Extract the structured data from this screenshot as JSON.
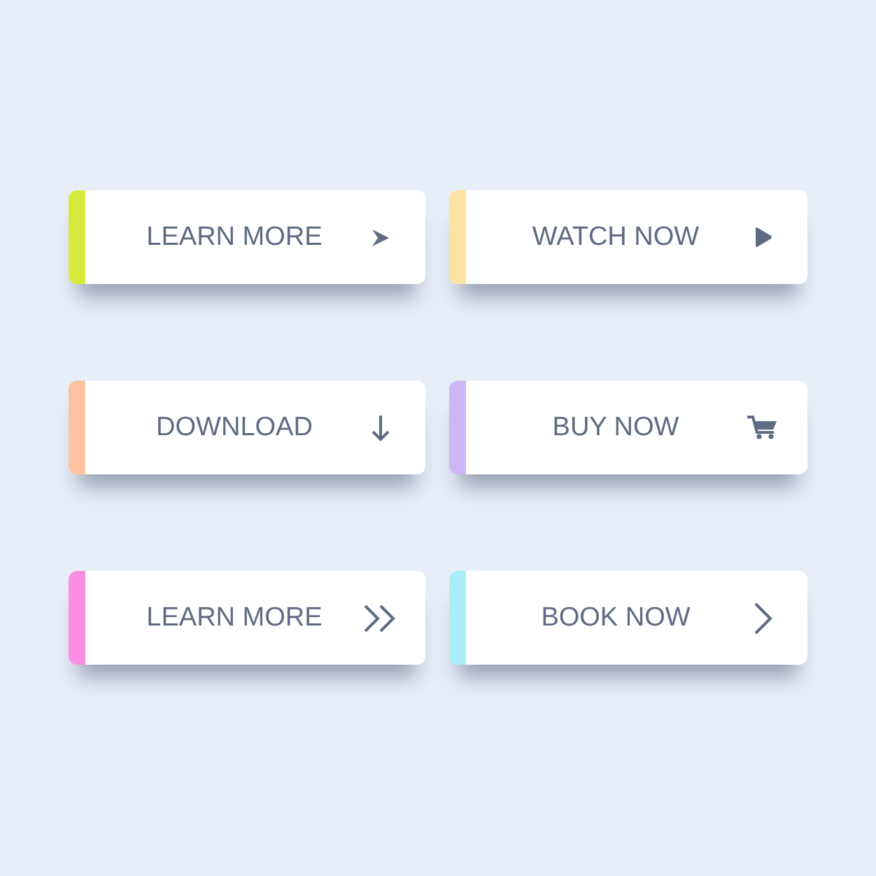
{
  "buttons": [
    {
      "label": "LEARN MORE",
      "color": "#d6ea3c"
    },
    {
      "label": "WATCH NOW",
      "color": "#fde2a2"
    },
    {
      "label": "DOWNLOAD",
      "color": "#fdc3a0"
    },
    {
      "label": "BUY NOW",
      "color": "#cdb6f6"
    },
    {
      "label": "LEARN MORE",
      "color": "#f98ee3"
    },
    {
      "label": "BOOK NOW",
      "color": "#a9eefb"
    }
  ]
}
